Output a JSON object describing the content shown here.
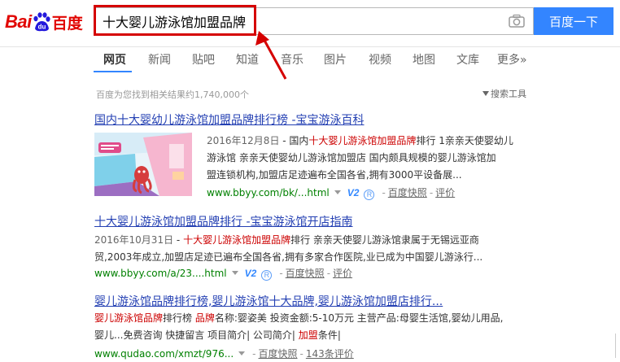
{
  "logo": {
    "text_latin": "Bai",
    "text_cn": "百度",
    "paw_text": "du"
  },
  "search": {
    "query": "十大婴儿游泳馆加盟品牌",
    "button_label": "百度一下"
  },
  "nav": {
    "tabs": [
      "网页",
      "新闻",
      "贴吧",
      "知道",
      "音乐",
      "图片",
      "视频",
      "地图",
      "文库",
      "更多»"
    ],
    "active": "网页"
  },
  "result_count": "百度为您找到相关结果约1,740,000个",
  "tools_label": "搜索工具",
  "results": [
    {
      "title": "国内十大婴幼儿游泳馆加盟品牌排行榜 -宝宝游泳百科",
      "date": "2016年12月8日",
      "sep": " - 国内",
      "hl1": "十大婴儿游泳馆加盟品牌",
      "body1": "排行 1亲亲天使婴幼儿",
      "line2": "游泳馆 亲亲天使婴幼儿游泳馆加盟店 国内颇具规模的婴儿游泳馆加",
      "line3": "盟连锁机构,加盟店足迹遍布全国各省,拥有3000平设备展...",
      "url": "www.bbyy.com/bk/...html",
      "v2": "V2",
      "r": "R",
      "cache": "百度快照",
      "eval": "评价"
    },
    {
      "title": "十大婴儿游泳馆加盟品牌排行 -宝宝游泳馆开店指南",
      "date": "2016年10月31日",
      "sep": " - ",
      "hl1": "十大婴儿游泳馆加盟品牌",
      "body1": "排行 亲亲天使婴儿游泳馆隶属于无锡远亚商",
      "line2": "贸,2003年成立,加盟店足迹已遍布全国各省,拥有多家合作医院,业已成为中国婴儿游泳行...",
      "url": "www.bbyy.com/a/23....html",
      "v2": "V2",
      "r": "R",
      "cache": "百度快照",
      "eval": "评价"
    },
    {
      "title": "婴儿游泳馆品牌排行榜,婴儿游泳馆十大品牌,婴儿游泳馆加盟店排行...",
      "hl0": "婴儿游泳馆品牌",
      "body0": "排行榜 ",
      "hl0b": "品牌",
      "body0b": "名称:婴姿美 投资金额:5-10万元 主营产品:母婴生活馆,婴幼儿用品,",
      "line2a": "婴儿...免费咨询 快捷留言 项目简介| 公司简介| ",
      "line2hl": "加盟",
      "line2b": "条件|",
      "url": "www.qudao.com/xmzt/976...",
      "cache": "百度快照",
      "eval": "143条评价"
    }
  ],
  "colors": {
    "brand_red": "#e10602",
    "brand_blue": "#2319dc",
    "button_blue": "#3385ff",
    "link_blue": "#2440b3",
    "highlight_red": "#c00",
    "url_green": "#008000",
    "annotation_red": "#d50000"
  },
  "icons": [
    "baidu-paw-icon",
    "camera-icon",
    "funnel-icon",
    "dropdown-arrow-icon",
    "v2-badge-icon",
    "r-badge-icon"
  ]
}
